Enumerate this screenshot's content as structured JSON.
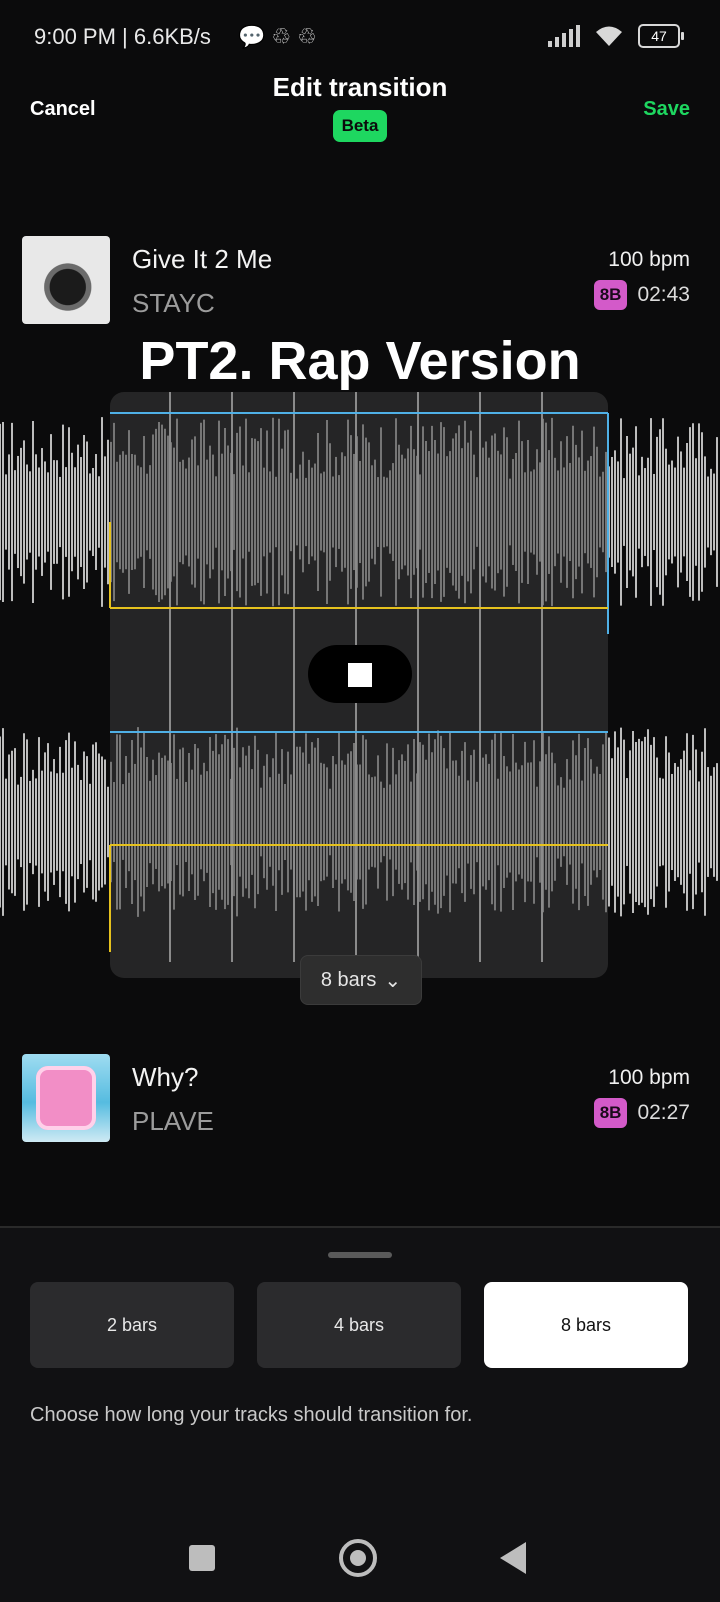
{
  "status": {
    "time": "9:00 PM | 6.6KB/s",
    "battery": "47",
    "icons": [
      "chat-icon",
      "sync-icon",
      "sync-icon",
      "signal-icon",
      "wifi-icon",
      "battery-icon"
    ]
  },
  "header": {
    "cancel_label": "Cancel",
    "title": "Edit transition",
    "badge": "Beta",
    "save_label": "Save"
  },
  "tracks": [
    {
      "name": "Give It 2 Me",
      "artist": "STAYC",
      "bpm": "100 bpm",
      "key": "8B",
      "duration": "02:43"
    },
    {
      "name": "Why?",
      "artist": "PLAVE",
      "bpm": "100 bpm",
      "key": "8B",
      "duration": "02:27"
    }
  ],
  "overlay_title": "PT2. Rap Version",
  "editor": {
    "bars_label": "8 bars",
    "chevron": "⌄",
    "stop_icon": "stop-icon"
  },
  "transition_sheet": {
    "options": [
      "2 bars",
      "4 bars",
      "8 bars"
    ],
    "selected": "8 bars",
    "hint": "Choose how long your tracks should transition for."
  },
  "colors": {
    "accent": "#1ed760",
    "key_badge": "#d35ac9",
    "grid_blue": "#4fb0e6",
    "grid_yellow": "#e6c21e"
  }
}
